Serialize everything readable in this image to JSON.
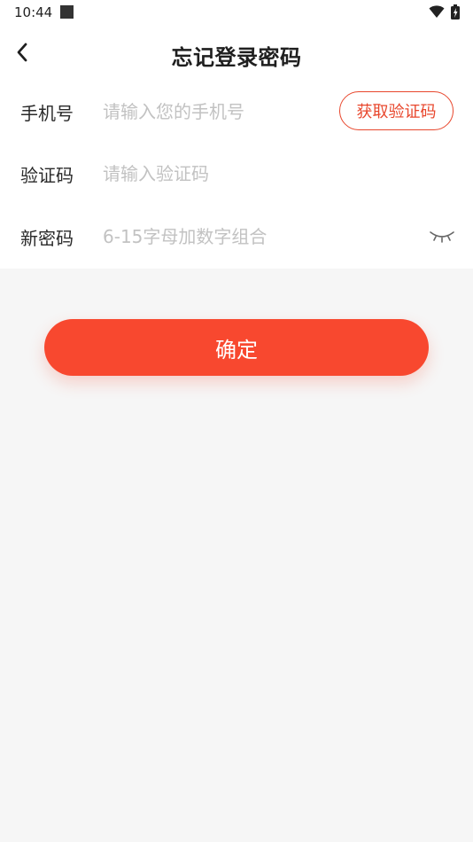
{
  "status_bar": {
    "time": "10:44"
  },
  "header": {
    "title": "忘记登录密码"
  },
  "form": {
    "phone": {
      "label": "手机号",
      "placeholder": "请输入您的手机号",
      "button": "获取验证码"
    },
    "code": {
      "label": "验证码",
      "placeholder": "请输入验证码"
    },
    "password": {
      "label": "新密码",
      "placeholder": "6-15字母加数字组合"
    }
  },
  "confirm": {
    "label": "确定"
  },
  "colors": {
    "accent": "#f8482f",
    "placeholder": "#c2c2c2",
    "background": "#f6f6f6"
  },
  "icons": {
    "back": "chevron-left-icon",
    "password_toggle": "eye-closed-icon",
    "wifi": "wifi-icon",
    "battery": "battery-charging-icon"
  }
}
